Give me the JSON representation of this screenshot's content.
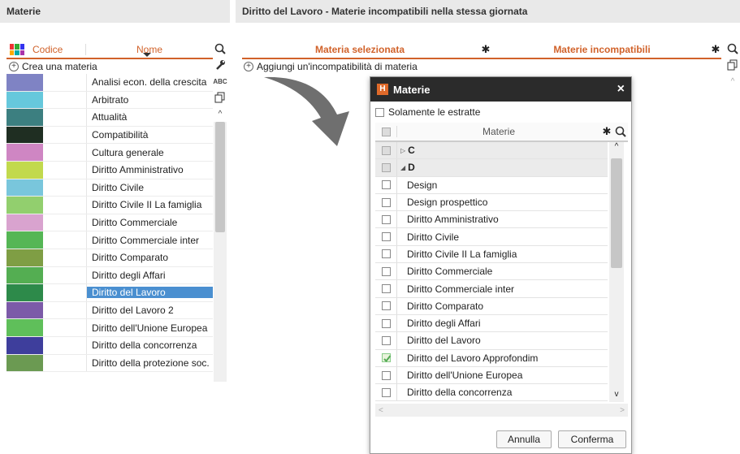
{
  "left_panel": {
    "title": "Materie",
    "col_codice": "Codice",
    "col_nome": "Nome",
    "create_label": "Crea una materia",
    "items": [
      {
        "name": "Analisi econ. della crescita",
        "color": "#7f83c4"
      },
      {
        "name": "Arbitrato",
        "color": "#66c8dc"
      },
      {
        "name": "Attualità",
        "color": "#3c7f80"
      },
      {
        "name": "Compatibilità",
        "color": "#1f2e22"
      },
      {
        "name": "Cultura generale",
        "color": "#cf86c3"
      },
      {
        "name": "Diritto Amministrativo",
        "color": "#c2d94d"
      },
      {
        "name": "Diritto Civile",
        "color": "#79c6dc"
      },
      {
        "name": "Diritto Civile II La famiglia",
        "color": "#92cf6e"
      },
      {
        "name": "Diritto Commerciale",
        "color": "#d9a3cf"
      },
      {
        "name": "Diritto Commerciale inter",
        "color": "#55b655"
      },
      {
        "name": "Diritto Comparato",
        "color": "#7f9e44"
      },
      {
        "name": "Diritto degli Affari",
        "color": "#54ae52"
      },
      {
        "name": "Diritto del Lavoro",
        "color": "#2d8a4a",
        "selected": true
      },
      {
        "name": "Diritto del Lavoro 2",
        "color": "#7c5aa8"
      },
      {
        "name": "Diritto dell'Unione Europea",
        "color": "#5fbf5a"
      },
      {
        "name": "Diritto della concorrenza",
        "color": "#3e3e9c"
      },
      {
        "name": "Diritto della protezione soc.",
        "color": "#6b9a52"
      }
    ]
  },
  "right_panel": {
    "title": "Diritto del Lavoro - Materie incompatibili nella stessa giornata",
    "col_selected": "Materia selezionata",
    "col_incompatible": "Materie incompatibili",
    "add_label": "Aggiungi un'incompatibilità di materia"
  },
  "modal": {
    "title": "Materie",
    "close": "×",
    "only_extracted": "Solamente le estratte",
    "col_header": "Materie",
    "rows": [
      {
        "label": "C",
        "group": true,
        "arrow": "▷"
      },
      {
        "label": "D",
        "group": true,
        "arrow": "◢"
      },
      {
        "label": "Design"
      },
      {
        "label": "Design prospettico"
      },
      {
        "label": "Diritto Amministrativo"
      },
      {
        "label": "Diritto Civile"
      },
      {
        "label": "Diritto Civile II La famiglia"
      },
      {
        "label": "Diritto Commerciale"
      },
      {
        "label": "Diritto Commerciale inter"
      },
      {
        "label": "Diritto Comparato"
      },
      {
        "label": "Diritto degli Affari"
      },
      {
        "label": "Diritto del Lavoro"
      },
      {
        "label": "Diritto del Lavoro Approfondim",
        "checked": true
      },
      {
        "label": "Diritto dell'Unione Europea"
      },
      {
        "label": "Diritto della concorrenza"
      }
    ],
    "cancel": "Annulla",
    "confirm": "Conferma"
  },
  "colors": {
    "accent": "#d1622a",
    "selection": "#4a8fd0"
  }
}
